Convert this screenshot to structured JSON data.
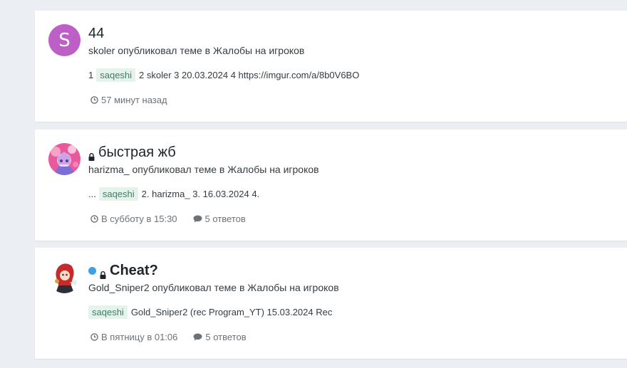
{
  "topics": [
    {
      "title": "44",
      "author_line": "skoler опубликовал теме в Жалобы на игроков",
      "snippet_prefix": "1",
      "tag": "saqeshi",
      "snippet_suffix": "2 skoler 3 20.03.2024 4 https://imgur.com/a/8b0V6BO",
      "time": "57 минут назад",
      "avatar_letter": "S",
      "avatar_color": "#bd5fc6"
    },
    {
      "title": "быстрая жб",
      "author_line": "harizma_ опубликовал теме в Жалобы на игроков",
      "snippet_prefix": "...",
      "tag": "saqeshi",
      "snippet_suffix": "2. harizma_ 3. 16.03.2024 4.",
      "time": "В субботу в 15:30",
      "replies": "5 ответов",
      "locked": true
    },
    {
      "title": "Cheat?",
      "author_line": "Gold_Sniper2 опубликовал теме в Жалобы на игроков",
      "tag": "saqeshi",
      "snippet_suffix": "Gold_Sniper2 (rec Program_YT) 15.03.2024 Rec",
      "time": "В пятницу в 01:06",
      "replies": "5 ответов",
      "locked": true,
      "unread": true
    }
  ],
  "colors": {
    "tag_bg": "#e6f2ec",
    "tag_text": "#3f7e67",
    "unread_dot": "#3aa1e6"
  }
}
